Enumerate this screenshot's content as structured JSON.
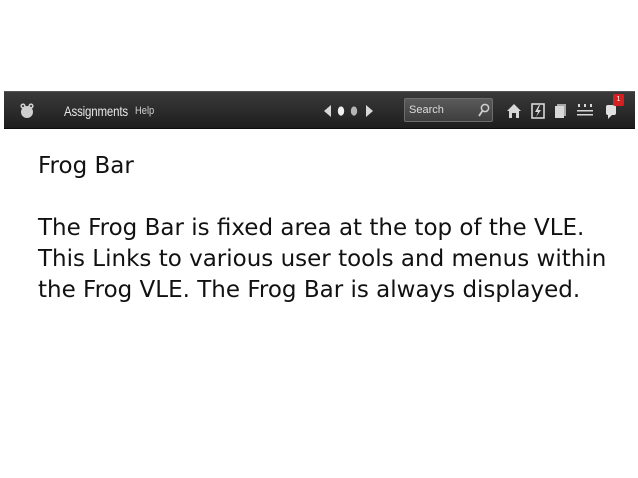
{
  "frog_bar": {
    "logo_icon": "frog-icon",
    "menu": [
      {
        "label": "Assignments"
      },
      {
        "label": "Help"
      }
    ],
    "search": {
      "placeholder": "Search",
      "icon": "search-icon"
    },
    "tools": [
      "home-icon",
      "lightning-icon",
      "documents-icon",
      "settings-grid-icon",
      "notifications-icon"
    ],
    "notification_count": "1",
    "colors": {
      "bar": "#2b2b2b",
      "badge": "#d42020"
    }
  },
  "slide": {
    "title": "Frog Bar",
    "body": "The Frog Bar is fixed area at the top of the VLE. This Links to various user tools and menus within the Frog VLE. The Frog Bar is always displayed."
  }
}
